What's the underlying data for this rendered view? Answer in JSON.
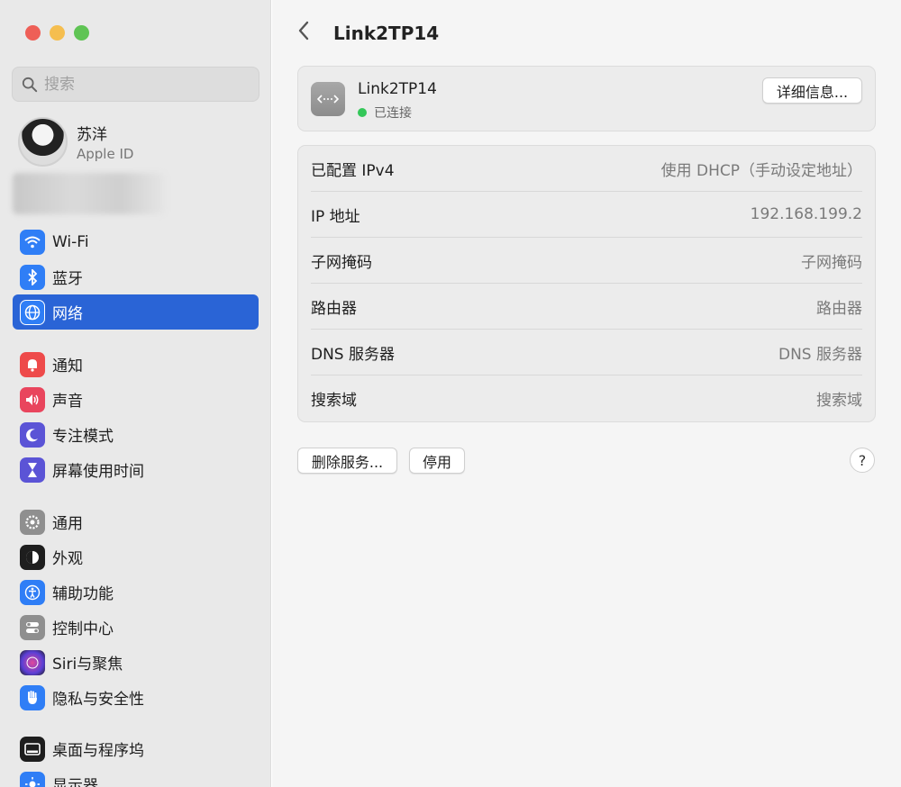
{
  "sidebar": {
    "search_placeholder": "搜索",
    "profile": {
      "name": "苏洋",
      "subtitle": "Apple ID"
    },
    "items": [
      {
        "label": "Wi-Fi",
        "icon": "wifi-icon",
        "color": "#2f7ef6"
      },
      {
        "label": "蓝牙",
        "icon": "bluetooth-icon",
        "color": "#2f7ef6"
      },
      {
        "label": "网络",
        "icon": "globe-icon",
        "color": "#2f7ef6",
        "selected": true
      },
      {
        "label": "通知",
        "icon": "bell-icon",
        "color": "#ee4a4a"
      },
      {
        "label": "声音",
        "icon": "speaker-icon",
        "color": "#e9455d"
      },
      {
        "label": "专注模式",
        "icon": "moon-icon",
        "color": "#5b54d6"
      },
      {
        "label": "屏幕使用时间",
        "icon": "hourglass-icon",
        "color": "#5b54d6"
      },
      {
        "label": "通用",
        "icon": "gear-icon",
        "color": "#8f8f8f"
      },
      {
        "label": "外观",
        "icon": "appearance-icon",
        "color": "#1e1e1e"
      },
      {
        "label": "辅助功能",
        "icon": "accessibility-icon",
        "color": "#2f7ef6"
      },
      {
        "label": "控制中心",
        "icon": "toggles-icon",
        "color": "#8f8f8f"
      },
      {
        "label": "Siri与聚焦",
        "icon": "siri-icon",
        "color": "#6d3fb3"
      },
      {
        "label": "隐私与安全性",
        "icon": "hand-icon",
        "color": "#2f7ef6"
      },
      {
        "label": "桌面与程序坞",
        "icon": "dock-icon",
        "color": "#1e1e1e"
      },
      {
        "label": "显示器",
        "icon": "sun-icon",
        "color": "#2f7ef6"
      }
    ]
  },
  "main": {
    "title": "Link2TP14",
    "service": {
      "name": "Link2TP14",
      "status": "已连接",
      "details_button": "详细信息..."
    },
    "rows": [
      {
        "label": "已配置 IPv4",
        "value": "使用 DHCP（手动设定地址）"
      },
      {
        "label": "IP 地址",
        "value": "192.168.199.2"
      },
      {
        "label": "子网掩码",
        "value": "子网掩码"
      },
      {
        "label": "路由器",
        "value": "路由器"
      },
      {
        "label": "DNS 服务器",
        "value": "DNS 服务器"
      },
      {
        "label": "搜索域",
        "value": "搜索域"
      }
    ],
    "buttons": {
      "delete": "删除服务...",
      "disable": "停用",
      "help": "?"
    }
  }
}
